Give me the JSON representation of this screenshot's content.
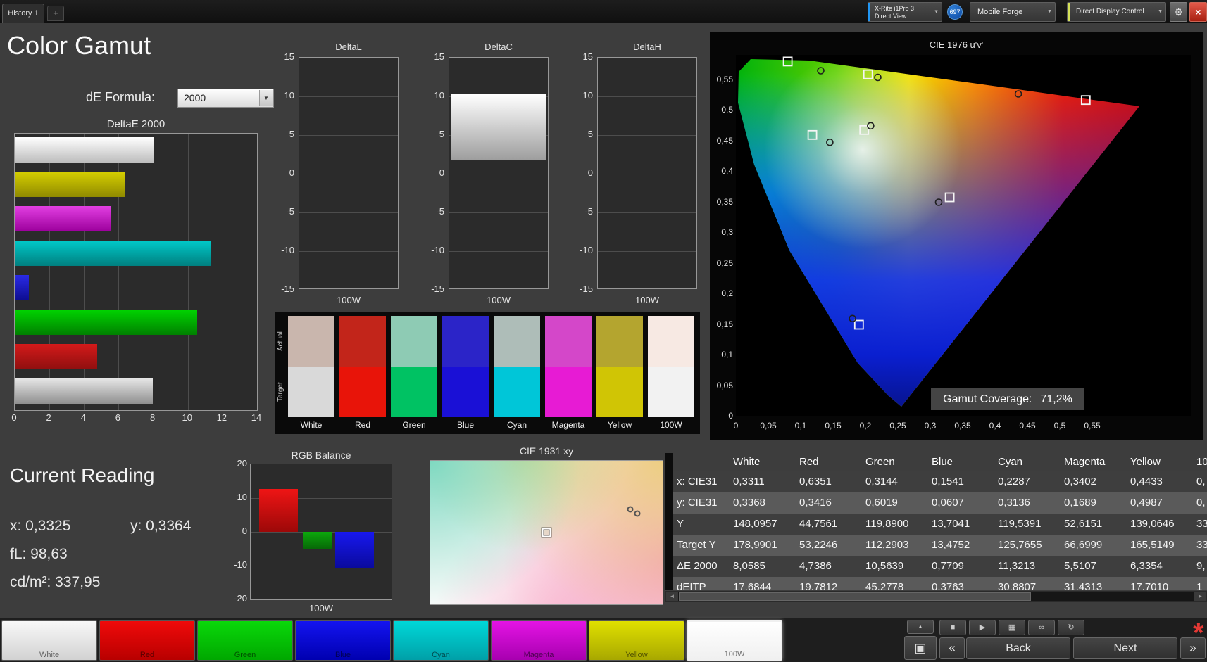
{
  "topbar": {
    "history_tab": "History 1",
    "add_tab": "+",
    "meter_device": {
      "line1": "X-Rite i1Pro 3",
      "line2": "Direct View",
      "accent": "#2196f3"
    },
    "badge_count": "697",
    "source_device": "Mobile Forge",
    "display_control": "Direct Display Control",
    "display_control_accent": "#d4e157",
    "gear_glyph": "⚙",
    "close_glyph": "×",
    "dropdown_arrow": "▼"
  },
  "page_title": "Color Gamut",
  "de_formula": {
    "label": "dE Formula:",
    "value": "2000"
  },
  "deltae_chart": {
    "type": "bar",
    "title": "DeltaE 2000",
    "orientation": "horizontal",
    "xlim": [
      0,
      14
    ],
    "x_ticks": [
      0,
      2,
      4,
      6,
      8,
      10,
      12,
      14
    ],
    "bars": [
      {
        "name": "White",
        "value": 8.06,
        "c1": "#ffffff",
        "c2": "#bdbdbd"
      },
      {
        "name": "Yellow",
        "value": 6.34,
        "c1": "#d6cf00",
        "c2": "#8f8a00"
      },
      {
        "name": "Magenta",
        "value": 5.51,
        "c1": "#e23fe2",
        "c2": "#9c009c"
      },
      {
        "name": "Cyan",
        "value": 11.32,
        "c1": "#00c9c9",
        "c2": "#007f7f"
      },
      {
        "name": "Blue",
        "value": 0.77,
        "c1": "#2a2ae6",
        "c2": "#0d0d8f"
      },
      {
        "name": "Green",
        "value": 10.56,
        "c1": "#00d400",
        "c2": "#008000"
      },
      {
        "name": "Red",
        "value": 4.74,
        "c1": "#d41a1a",
        "c2": "#8f0f0f"
      },
      {
        "name": "100W",
        "value": 8.0,
        "c1": "#e6e6e6",
        "c2": "#8f8f8f"
      }
    ]
  },
  "delta_small_charts": {
    "ylim": [
      -15,
      15
    ],
    "y_ticks": [
      15,
      10,
      5,
      0,
      -5,
      -10,
      -15
    ],
    "xlabel": "100W",
    "charts": [
      {
        "title": "DeltaL",
        "bar": null
      },
      {
        "title": "DeltaC",
        "bar": {
          "from": 1.8,
          "to": 10.3
        }
      },
      {
        "title": "DeltaH",
        "bar": null
      }
    ]
  },
  "swatches": {
    "row_labels": [
      "Actual",
      "Target"
    ],
    "items": [
      {
        "label": "White",
        "actual": "#c9b6ad",
        "target": "#d9d9d9"
      },
      {
        "label": "Red",
        "actual": "#c2251a",
        "target": "#e81409"
      },
      {
        "label": "Green",
        "actual": "#8ecbb4",
        "target": "#00c263"
      },
      {
        "label": "Blue",
        "actual": "#2b24c8",
        "target": "#1a10d6"
      },
      {
        "label": "Cyan",
        "actual": "#aebdb8",
        "target": "#00c6d8"
      },
      {
        "label": "Magenta",
        "actual": "#d447c9",
        "target": "#e71bd4"
      },
      {
        "label": "Yellow",
        "actual": "#b4a52f",
        "target": "#d0c505"
      },
      {
        "label": "100W",
        "actual": "#f7e9e3",
        "target": "#f2f2f2"
      }
    ]
  },
  "cie1976": {
    "title": "CIE 1976 u'v'",
    "x_ticks": [
      "0",
      "0,05",
      "0,1",
      "0,15",
      "0,2",
      "0,25",
      "0,3",
      "0,35",
      "0,4",
      "0,45",
      "0,5",
      "0,55"
    ],
    "y_ticks": [
      "0",
      "0,05",
      "0,1",
      "0,15",
      "0,2",
      "0,25",
      "0,3",
      "0,35",
      "0,4",
      "0,45",
      "0,5",
      "0,55"
    ],
    "coverage_label": "Gamut Coverage:",
    "coverage_value": "71,2%",
    "markers": [
      {
        "name": "green",
        "square": [
          0.08,
          0.58
        ],
        "circle": [
          0.131,
          0.565
        ]
      },
      {
        "name": "yellow",
        "square": [
          0.204,
          0.559
        ],
        "circle": [
          0.219,
          0.554
        ]
      },
      {
        "name": "red",
        "square": [
          0.54,
          0.517
        ],
        "circle": [
          0.436,
          0.527
        ]
      },
      {
        "name": "white",
        "square": [
          0.198,
          0.468
        ],
        "circle": [
          0.208,
          0.475
        ]
      },
      {
        "name": "cyan",
        "square": [
          0.118,
          0.46
        ],
        "circle": [
          0.145,
          0.448
        ]
      },
      {
        "name": "magenta",
        "square": [
          0.33,
          0.358
        ],
        "circle": [
          0.313,
          0.35
        ]
      },
      {
        "name": "blue",
        "square": [
          0.19,
          0.15
        ],
        "circle": [
          0.18,
          0.16
        ]
      }
    ]
  },
  "current_reading": {
    "title": "Current Reading",
    "x": "x: 0,3325",
    "y": "y: 0,3364",
    "fl": "fL: 98,63",
    "cd": "cd/m²: 337,95"
  },
  "rgb_balance": {
    "type": "bar",
    "title": "RGB Balance",
    "ylim": [
      -20,
      20
    ],
    "y_ticks": [
      20,
      10,
      0,
      -10,
      -20
    ],
    "xlabel": "100W",
    "bars": [
      {
        "name": "Red",
        "value": 12.7,
        "c1": "#ef1515",
        "c2": "#9c0808"
      },
      {
        "name": "Green",
        "value": -5.0,
        "c1": "#0ca80c",
        "c2": "#076807"
      },
      {
        "name": "Blue",
        "value": -10.8,
        "c1": "#1818ef",
        "c2": "#0a0a9c"
      }
    ]
  },
  "cie1931": {
    "title": "CIE 1931 xy",
    "markers": {
      "square": [
        50,
        50
      ],
      "circles": [
        [
          86,
          34
        ],
        [
          89,
          37
        ]
      ]
    }
  },
  "table": {
    "scroll_left_glyph": "◄",
    "scroll_right_glyph": "►",
    "headers": [
      "",
      "White",
      "Red",
      "Green",
      "Blue",
      "Cyan",
      "Magenta",
      "Yellow",
      "10"
    ],
    "rows": [
      {
        "label": "x: CIE31",
        "values": [
          "0,3311",
          "0,6351",
          "0,3144",
          "0,1541",
          "0,2287",
          "0,3402",
          "0,4433",
          "0,"
        ]
      },
      {
        "label": "y: CIE31",
        "values": [
          "0,3368",
          "0,3416",
          "0,6019",
          "0,0607",
          "0,3136",
          "0,1689",
          "0,4987",
          "0,"
        ]
      },
      {
        "label": "Y",
        "values": [
          "148,0957",
          "44,7561",
          "119,8900",
          "13,7041",
          "119,5391",
          "52,6151",
          "139,0646",
          "33"
        ]
      },
      {
        "label": "Target Y",
        "values": [
          "178,9901",
          "53,2246",
          "112,2903",
          "13,4752",
          "125,7655",
          "66,6999",
          "165,5149",
          "33"
        ]
      },
      {
        "label": "ΔE 2000",
        "values": [
          "8,0585",
          "4,7386",
          "10,5639",
          "0,7709",
          "11,3213",
          "5,5107",
          "6,3354",
          "9,"
        ]
      },
      {
        "label": "dEITP",
        "values": [
          "17,6844",
          "19,7812",
          "45,2778",
          "0,3763",
          "30,8807",
          "31,4313",
          "17,7010",
          "1"
        ]
      }
    ]
  },
  "pattern_buttons": [
    {
      "label": "White",
      "c1": "#f8f8f8",
      "c2": "#d2d2d2",
      "selected": false
    },
    {
      "label": "Red",
      "c1": "#f00a0a",
      "c2": "#b80000",
      "selected": false
    },
    {
      "label": "Green",
      "c1": "#0ad80a",
      "c2": "#00a800",
      "selected": false
    },
    {
      "label": "Blue",
      "c1": "#1414f0",
      "c2": "#0000b0",
      "selected": false
    },
    {
      "label": "Cyan",
      "c1": "#00d8d8",
      "c2": "#00a0a8",
      "selected": false
    },
    {
      "label": "Magenta",
      "c1": "#e414e4",
      "c2": "#a800b0",
      "selected": false
    },
    {
      "label": "Yellow",
      "c1": "#e0e000",
      "c2": "#a8a800",
      "selected": false
    },
    {
      "label": "100W",
      "c1": "#ffffff",
      "c2": "#f0f0f0",
      "selected": true
    }
  ],
  "transport": {
    "eject": "▲",
    "window": "▣",
    "buttons": [
      {
        "name": "stop",
        "glyph": "■"
      },
      {
        "name": "play",
        "glyph": "▶"
      },
      {
        "name": "pattern-grid",
        "glyph": "▦"
      },
      {
        "name": "continuous",
        "glyph": "∞"
      },
      {
        "name": "refresh",
        "glyph": "↻"
      }
    ],
    "prev_glyph": "«",
    "back_label": "Back",
    "next_label": "Next",
    "next_glyph": "»",
    "alert_glyph": "*"
  }
}
